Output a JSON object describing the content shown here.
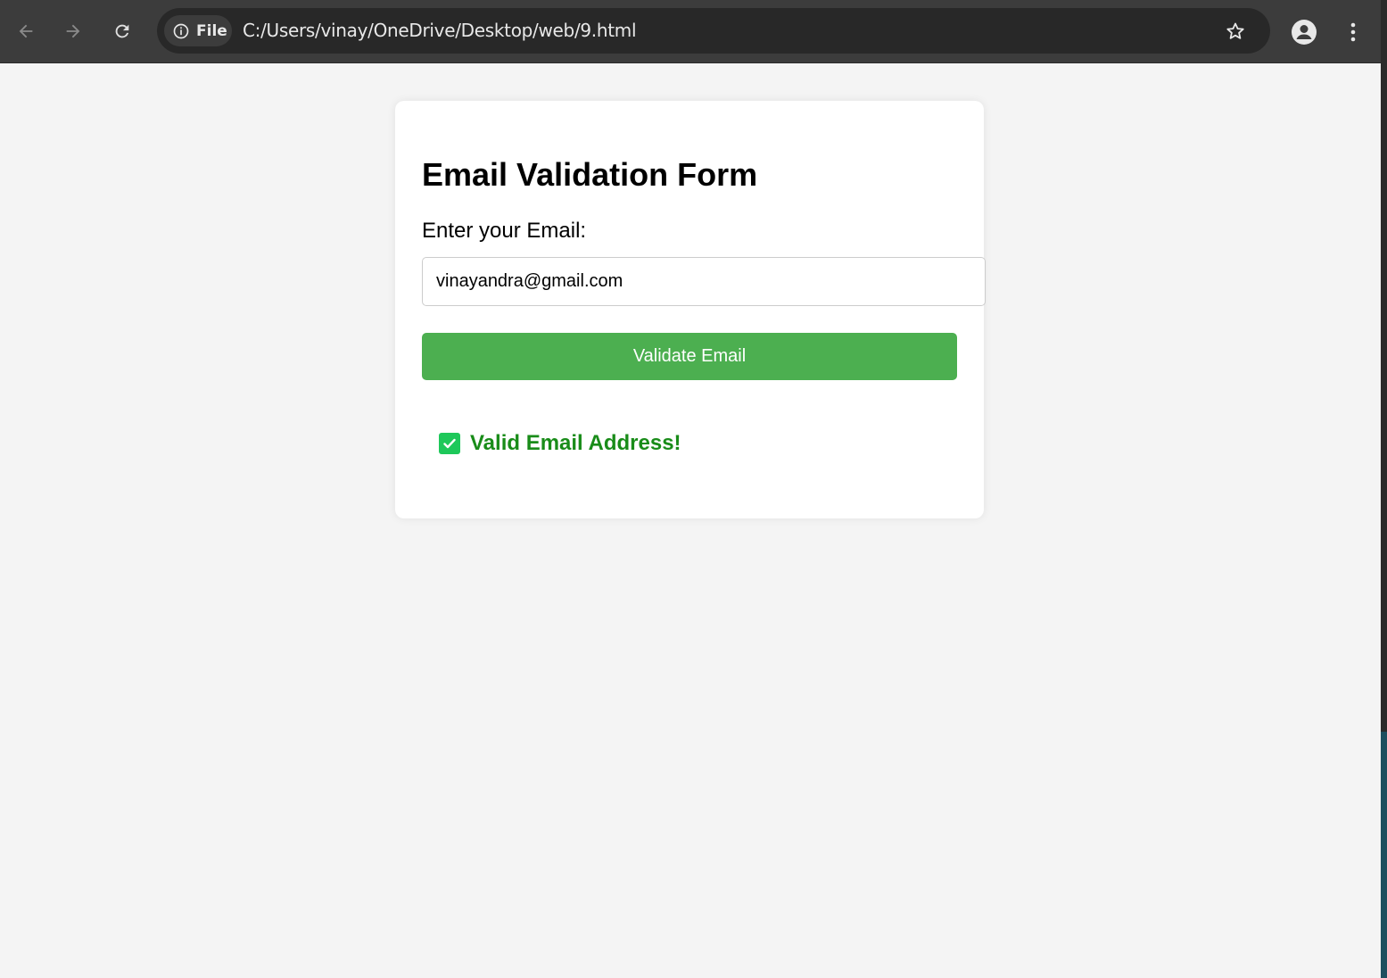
{
  "browser": {
    "chip_label": "File",
    "url": "C:/Users/vinay/OneDrive/Desktop/web/9.html",
    "theme_color": "#3c3c3c"
  },
  "form": {
    "title": "Email Validation Form",
    "email_label": "Enter your Email:",
    "email_value": "vinayandra@gmail.com",
    "button_label": "Validate Email",
    "button_color": "#4caf50",
    "result_text": "Valid Email Address!",
    "result_color": "#198c19",
    "result_icon": "check-mark-icon"
  }
}
